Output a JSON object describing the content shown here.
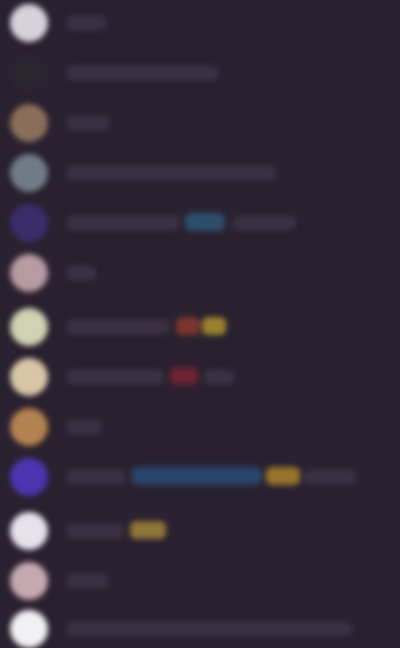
{
  "window": {
    "title": ""
  },
  "rows": [
    {
      "name": "",
      "avatar_color": "#d6d2db",
      "name_width_px_hint": "short"
    },
    {
      "name": "",
      "avatar_color": "#2b2530",
      "name_width_px_hint": "long"
    },
    {
      "name": "",
      "avatar_color": "#8b6e5a",
      "name_width_px_hint": "short"
    },
    {
      "name": "",
      "avatar_color": "#6f7c86",
      "name_width_px_hint": "very-long"
    },
    {
      "name": "",
      "avatar_color": "#3b2d6a",
      "name_width_px_hint": "long",
      "badges": [
        {
          "color": "#2e5a7a"
        }
      ]
    },
    {
      "name": "",
      "avatar_color": "#b79aa2",
      "name_width_px_hint": "short"
    },
    {
      "name": "",
      "avatar_color": "#cfd2b3",
      "name_width_px_hint": "medium",
      "badges": [
        {
          "color": "#8f3b2e"
        },
        {
          "color": "#b59a2a"
        }
      ]
    },
    {
      "name": "",
      "avatar_color": "#d8c5a7",
      "name_width_px_hint": "medium",
      "badges": [
        {
          "color": "#7b2430"
        }
      ]
    },
    {
      "name": "",
      "avatar_color": "#b38250",
      "name_width_px_hint": "short"
    },
    {
      "name": "",
      "avatar_color": "#4b35b0",
      "name_width_px_hint": "very-long",
      "badges": [
        {
          "color": "#2b4d7a"
        },
        {
          "color": "#b38a2a"
        }
      ]
    },
    {
      "name": "",
      "avatar_color": "#e6e1ea",
      "name_width_px_hint": "short",
      "badges": [
        {
          "color": "#a88a3a"
        }
      ]
    },
    {
      "name": "",
      "avatar_color": "#c6a8b0",
      "name_width_px_hint": "short"
    },
    {
      "name": "",
      "avatar_color": "#f1f0f2",
      "name_width_px_hint": "very-long"
    }
  ]
}
